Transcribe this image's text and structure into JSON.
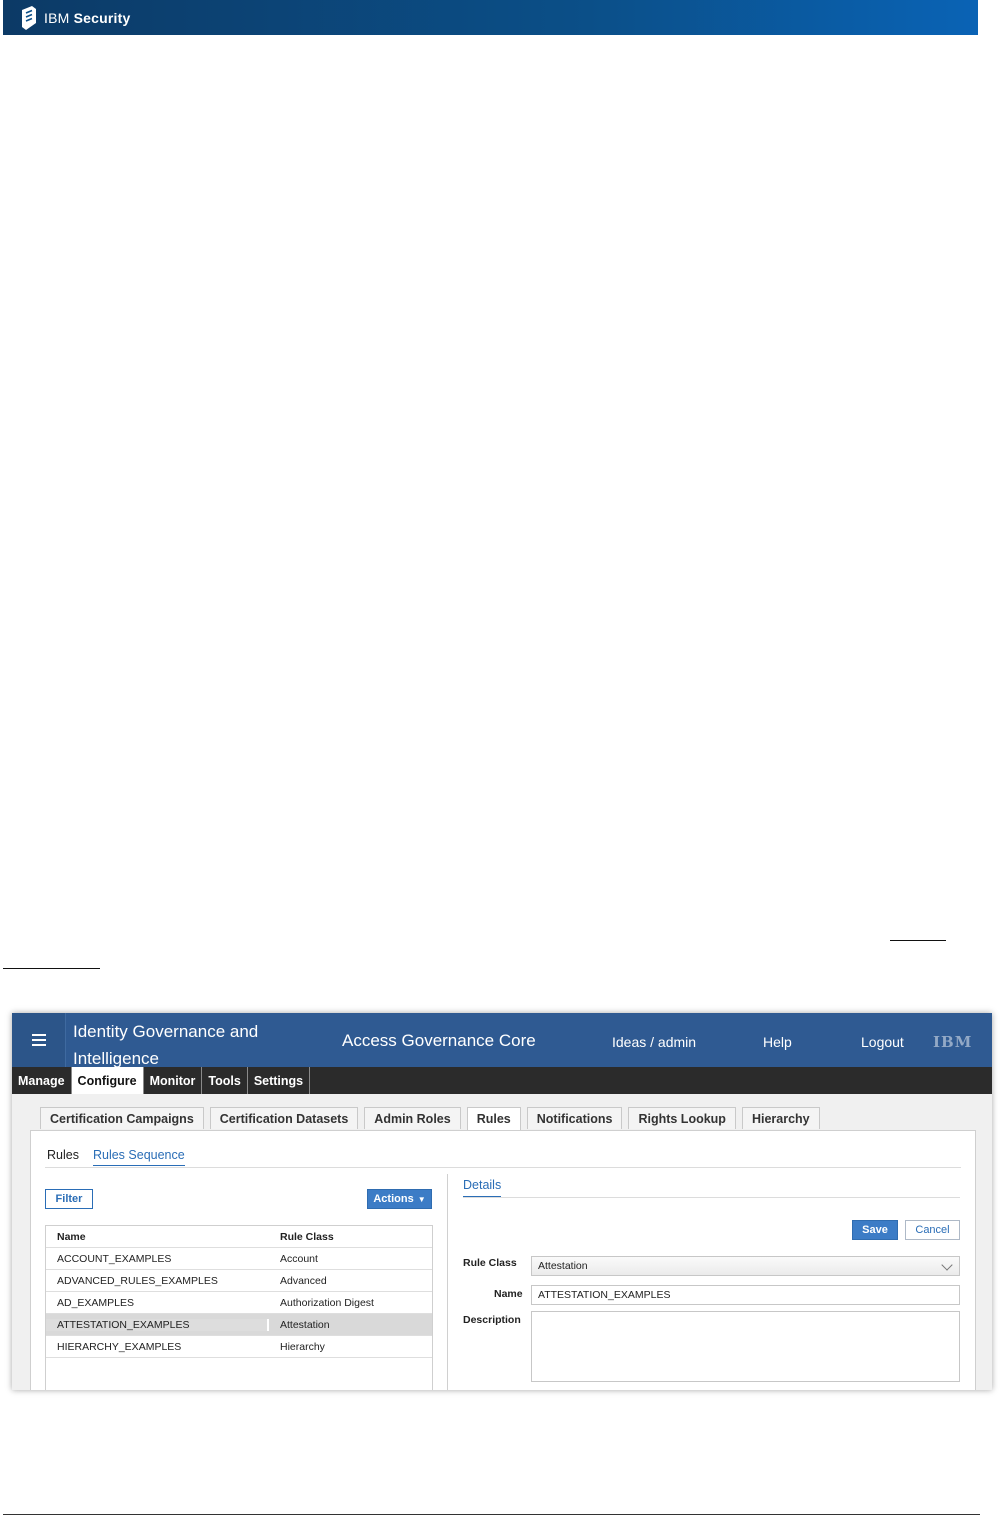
{
  "banner": {
    "brand_prefix": "IBM",
    "brand_name": "Security"
  },
  "app": {
    "title": "Identity Governance and Intelligence",
    "subtitle": "Access Governance Core",
    "user": "Ideas / admin",
    "help": "Help",
    "logout": "Logout",
    "ibm": "IBM"
  },
  "nav": [
    "Manage",
    "Configure",
    "Monitor",
    "Tools",
    "Settings"
  ],
  "tabs": [
    "Certification Campaigns",
    "Certification Datasets",
    "Admin Roles",
    "Rules",
    "Notifications",
    "Rights Lookup",
    "Hierarchy"
  ],
  "subtabs": [
    "Rules",
    "Rules Sequence"
  ],
  "toolbar": {
    "filter": "Filter",
    "actions": "Actions"
  },
  "grid": {
    "headers": [
      "Name",
      "Rule Class"
    ],
    "rows": [
      [
        "ACCOUNT_EXAMPLES",
        "Account"
      ],
      [
        "ADVANCED_RULES_EXAMPLES",
        "Advanced"
      ],
      [
        "AD_EXAMPLES",
        "Authorization Digest"
      ],
      [
        "ATTESTATION_EXAMPLES",
        "Attestation"
      ],
      [
        "HIERARCHY_EXAMPLES",
        "Hierarchy"
      ]
    ]
  },
  "details": {
    "tab": "Details",
    "save": "Save",
    "cancel": "Cancel",
    "rule_class_label": "Rule Class",
    "rule_class_value": "Attestation",
    "name_label": "Name",
    "name_value": "ATTESTATION_EXAMPLES",
    "description_label": "Description"
  },
  "colors": {
    "appbar": "#2f5a92",
    "navbar": "#2b2b2b",
    "accent": "#2a6db6"
  }
}
